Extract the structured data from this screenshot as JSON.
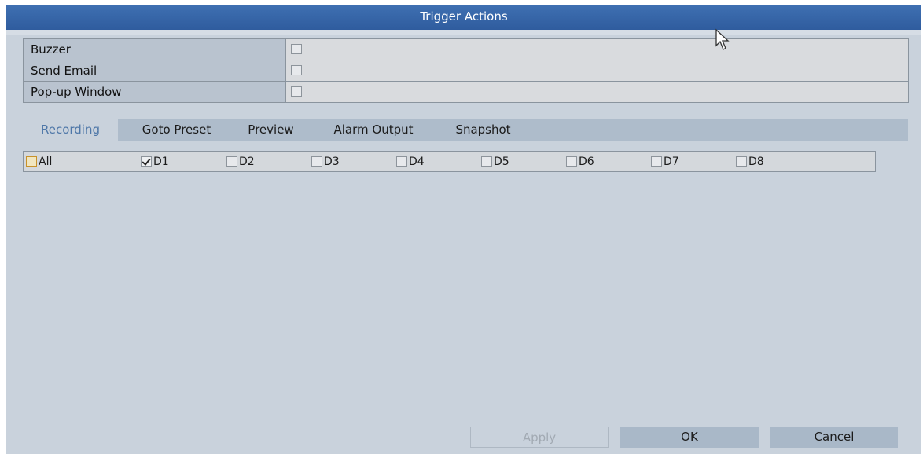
{
  "window": {
    "title": "Trigger Actions"
  },
  "options": [
    {
      "label": "Buzzer",
      "checked": false
    },
    {
      "label": "Send Email",
      "checked": false
    },
    {
      "label": "Pop-up Window",
      "checked": false
    }
  ],
  "tabs": [
    {
      "label": "Recording",
      "active": true
    },
    {
      "label": "Goto Preset",
      "active": false
    },
    {
      "label": "Preview",
      "active": false
    },
    {
      "label": "Alarm Output",
      "active": false
    },
    {
      "label": "Snapshot",
      "active": false
    }
  ],
  "channels": [
    {
      "label": "All",
      "checked": false
    },
    {
      "label": "D1",
      "checked": true
    },
    {
      "label": "D2",
      "checked": false
    },
    {
      "label": "D3",
      "checked": false
    },
    {
      "label": "D4",
      "checked": false
    },
    {
      "label": "D5",
      "checked": false
    },
    {
      "label": "D6",
      "checked": false
    },
    {
      "label": "D7",
      "checked": false
    },
    {
      "label": "D8",
      "checked": false
    }
  ],
  "buttons": {
    "apply": "Apply",
    "ok": "OK",
    "cancel": "Cancel"
  },
  "colors": {
    "titlebar": "#3a69ab",
    "panel": "#c9d2dc",
    "active_tab_text": "#4e77a8"
  }
}
